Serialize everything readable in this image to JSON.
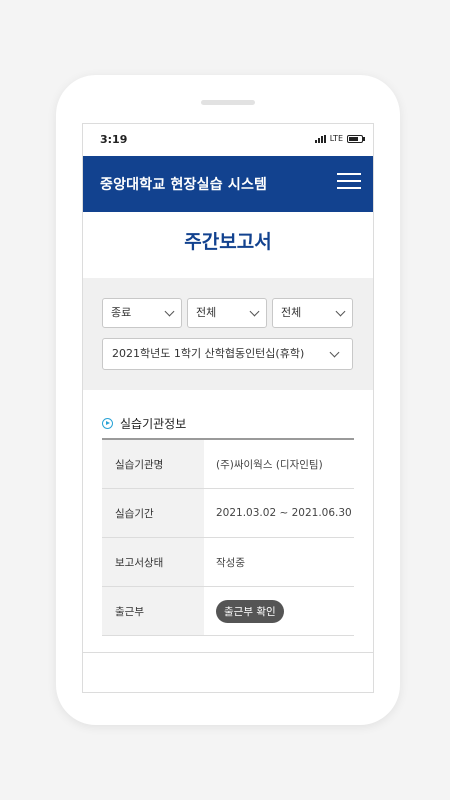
{
  "status_bar": {
    "time": "3:19",
    "network": "LTE"
  },
  "app_bar": {
    "title": "중앙대학교 현장실습 시스템"
  },
  "page": {
    "title": "주간보고서"
  },
  "filters": {
    "status_select": "종료",
    "filter2_select": "전체",
    "filter3_select": "전체",
    "program_select": "2021학년도 1학기 산학협동인턴십(휴학)"
  },
  "section": {
    "title": "실습기관정보"
  },
  "info": {
    "rows": [
      {
        "label": "실습기관명",
        "value": "(주)싸이웍스 (디자인팀)"
      },
      {
        "label": "실습기간",
        "value": "2021.03.02 ~ 2021.06.30"
      },
      {
        "label": "보고서상태",
        "value": "작성중"
      },
      {
        "label": "출근부",
        "button": "출근부 확인"
      }
    ]
  },
  "colors": {
    "brand": "#12428f",
    "accent": "#2aa3d6"
  }
}
